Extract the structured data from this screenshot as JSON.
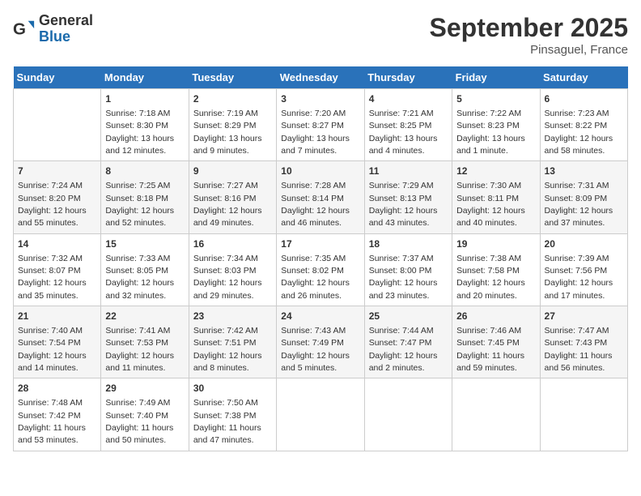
{
  "logo": {
    "general": "General",
    "blue": "Blue"
  },
  "title": "September 2025",
  "location": "Pinsaguel, France",
  "days_of_week": [
    "Sunday",
    "Monday",
    "Tuesday",
    "Wednesday",
    "Thursday",
    "Friday",
    "Saturday"
  ],
  "weeks": [
    [
      {
        "day": "",
        "content": ""
      },
      {
        "day": "1",
        "content": "Sunrise: 7:18 AM\nSunset: 8:30 PM\nDaylight: 13 hours and 12 minutes."
      },
      {
        "day": "2",
        "content": "Sunrise: 7:19 AM\nSunset: 8:29 PM\nDaylight: 13 hours and 9 minutes."
      },
      {
        "day": "3",
        "content": "Sunrise: 7:20 AM\nSunset: 8:27 PM\nDaylight: 13 hours and 7 minutes."
      },
      {
        "day": "4",
        "content": "Sunrise: 7:21 AM\nSunset: 8:25 PM\nDaylight: 13 hours and 4 minutes."
      },
      {
        "day": "5",
        "content": "Sunrise: 7:22 AM\nSunset: 8:23 PM\nDaylight: 13 hours and 1 minute."
      },
      {
        "day": "6",
        "content": "Sunrise: 7:23 AM\nSunset: 8:22 PM\nDaylight: 12 hours and 58 minutes."
      }
    ],
    [
      {
        "day": "7",
        "content": "Sunrise: 7:24 AM\nSunset: 8:20 PM\nDaylight: 12 hours and 55 minutes."
      },
      {
        "day": "8",
        "content": "Sunrise: 7:25 AM\nSunset: 8:18 PM\nDaylight: 12 hours and 52 minutes."
      },
      {
        "day": "9",
        "content": "Sunrise: 7:27 AM\nSunset: 8:16 PM\nDaylight: 12 hours and 49 minutes."
      },
      {
        "day": "10",
        "content": "Sunrise: 7:28 AM\nSunset: 8:14 PM\nDaylight: 12 hours and 46 minutes."
      },
      {
        "day": "11",
        "content": "Sunrise: 7:29 AM\nSunset: 8:13 PM\nDaylight: 12 hours and 43 minutes."
      },
      {
        "day": "12",
        "content": "Sunrise: 7:30 AM\nSunset: 8:11 PM\nDaylight: 12 hours and 40 minutes."
      },
      {
        "day": "13",
        "content": "Sunrise: 7:31 AM\nSunset: 8:09 PM\nDaylight: 12 hours and 37 minutes."
      }
    ],
    [
      {
        "day": "14",
        "content": "Sunrise: 7:32 AM\nSunset: 8:07 PM\nDaylight: 12 hours and 35 minutes."
      },
      {
        "day": "15",
        "content": "Sunrise: 7:33 AM\nSunset: 8:05 PM\nDaylight: 12 hours and 32 minutes."
      },
      {
        "day": "16",
        "content": "Sunrise: 7:34 AM\nSunset: 8:03 PM\nDaylight: 12 hours and 29 minutes."
      },
      {
        "day": "17",
        "content": "Sunrise: 7:35 AM\nSunset: 8:02 PM\nDaylight: 12 hours and 26 minutes."
      },
      {
        "day": "18",
        "content": "Sunrise: 7:37 AM\nSunset: 8:00 PM\nDaylight: 12 hours and 23 minutes."
      },
      {
        "day": "19",
        "content": "Sunrise: 7:38 AM\nSunset: 7:58 PM\nDaylight: 12 hours and 20 minutes."
      },
      {
        "day": "20",
        "content": "Sunrise: 7:39 AM\nSunset: 7:56 PM\nDaylight: 12 hours and 17 minutes."
      }
    ],
    [
      {
        "day": "21",
        "content": "Sunrise: 7:40 AM\nSunset: 7:54 PM\nDaylight: 12 hours and 14 minutes."
      },
      {
        "day": "22",
        "content": "Sunrise: 7:41 AM\nSunset: 7:53 PM\nDaylight: 12 hours and 11 minutes."
      },
      {
        "day": "23",
        "content": "Sunrise: 7:42 AM\nSunset: 7:51 PM\nDaylight: 12 hours and 8 minutes."
      },
      {
        "day": "24",
        "content": "Sunrise: 7:43 AM\nSunset: 7:49 PM\nDaylight: 12 hours and 5 minutes."
      },
      {
        "day": "25",
        "content": "Sunrise: 7:44 AM\nSunset: 7:47 PM\nDaylight: 12 hours and 2 minutes."
      },
      {
        "day": "26",
        "content": "Sunrise: 7:46 AM\nSunset: 7:45 PM\nDaylight: 11 hours and 59 minutes."
      },
      {
        "day": "27",
        "content": "Sunrise: 7:47 AM\nSunset: 7:43 PM\nDaylight: 11 hours and 56 minutes."
      }
    ],
    [
      {
        "day": "28",
        "content": "Sunrise: 7:48 AM\nSunset: 7:42 PM\nDaylight: 11 hours and 53 minutes."
      },
      {
        "day": "29",
        "content": "Sunrise: 7:49 AM\nSunset: 7:40 PM\nDaylight: 11 hours and 50 minutes."
      },
      {
        "day": "30",
        "content": "Sunrise: 7:50 AM\nSunset: 7:38 PM\nDaylight: 11 hours and 47 minutes."
      },
      {
        "day": "",
        "content": ""
      },
      {
        "day": "",
        "content": ""
      },
      {
        "day": "",
        "content": ""
      },
      {
        "day": "",
        "content": ""
      }
    ]
  ]
}
